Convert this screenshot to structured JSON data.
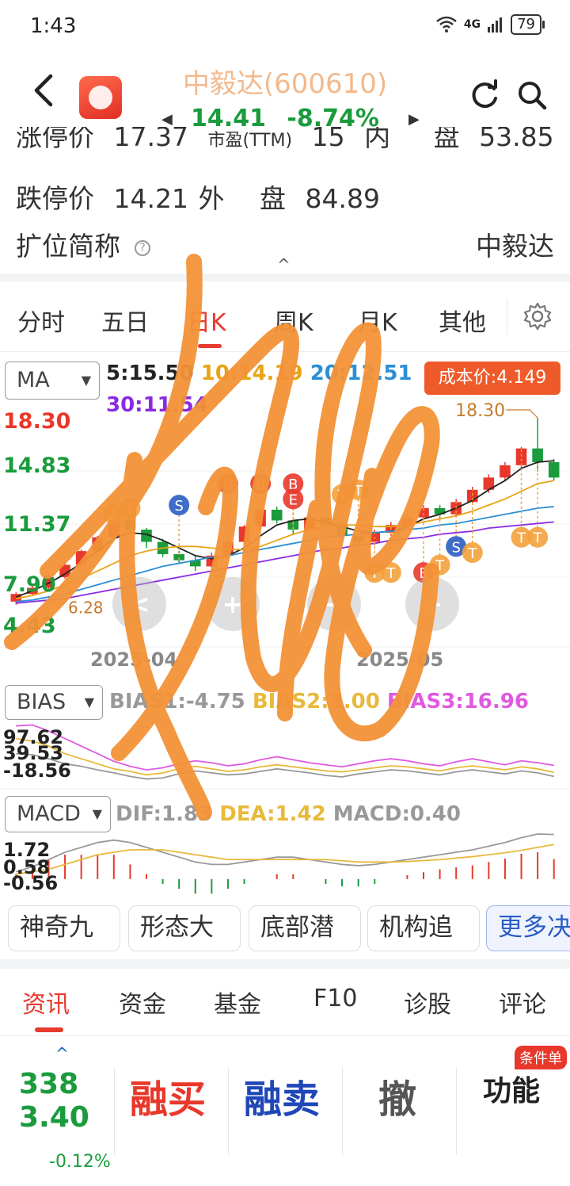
{
  "status_bar": {
    "time": "1:43",
    "network": "4G",
    "battery": "79"
  },
  "header": {
    "stock_name": "中毅达(600610)",
    "price": "14.41",
    "change_pct": "-8.74%",
    "prev_arrow": "◀",
    "next_arrow": "▶"
  },
  "info": {
    "row_cut": {
      "a": "涨停价",
      "b": "17.37",
      "c": "市盈(TTM)",
      "d": "15",
      "e": "内",
      "f": "盘",
      "g": "53.85"
    },
    "limit_down_label": "跌停价",
    "limit_down_value": "14.21",
    "outer_label": "外",
    "outer_mid": "盘",
    "outer_value": "84.89",
    "short_name_label": "扩位简称",
    "short_name_value": "中毅达"
  },
  "chart_tabs": [
    {
      "label": "分时"
    },
    {
      "label": "五日"
    },
    {
      "label": "日K"
    },
    {
      "label": "周K"
    },
    {
      "label": "月K"
    },
    {
      "label": "其他"
    }
  ],
  "ma": {
    "selector": "MA",
    "ma5": "5:15.50",
    "ma10": "10:14.19",
    "ma20": "20:12.51",
    "ma30": "30:11.54",
    "cost_price": "成本价:4.149",
    "colors": {
      "ma5": "#222222",
      "ma10": "#e8a417",
      "ma20": "#2b8fd6",
      "ma30": "#8b2be2"
    }
  },
  "chart_data": {
    "type": "candlestick",
    "price_axis_labels": [
      "18.30",
      "14.83",
      "11.37",
      "7.90",
      "4.43"
    ],
    "ylim": [
      4.43,
      18.3
    ],
    "high_annotation": "18.30",
    "low_annotation": "6.28",
    "x_labels": [
      "2025-04",
      "2025-05"
    ],
    "candles": [
      [
        6.3,
        6.8,
        6.1,
        6.9
      ],
      [
        6.8,
        7.2,
        6.7,
        7.4
      ],
      [
        7.2,
        7.9,
        7.0,
        8.1
      ],
      [
        7.9,
        8.7,
        7.8,
        8.8
      ],
      [
        8.7,
        9.6,
        8.6,
        9.7
      ],
      [
        9.6,
        10.5,
        9.4,
        10.6
      ],
      [
        10.5,
        11.6,
        10.3,
        11.7
      ],
      [
        11.6,
        11.0,
        10.8,
        11.9
      ],
      [
        11.0,
        10.2,
        9.8,
        11.1
      ],
      [
        10.2,
        9.4,
        9.2,
        10.4
      ],
      [
        9.4,
        9.0,
        8.8,
        9.6
      ],
      [
        9.0,
        8.6,
        8.3,
        9.3
      ],
      [
        8.6,
        9.3,
        8.5,
        9.5
      ],
      [
        9.3,
        10.2,
        9.1,
        10.3
      ],
      [
        10.2,
        11.2,
        10.0,
        11.3
      ],
      [
        11.2,
        12.3,
        11.0,
        12.4
      ],
      [
        12.3,
        11.6,
        11.4,
        12.5
      ],
      [
        11.6,
        11.0,
        10.7,
        11.8
      ],
      [
        11.0,
        11.8,
        10.9,
        12.0
      ],
      [
        11.8,
        11.3,
        11.1,
        12.0
      ],
      [
        11.3,
        10.6,
        10.4,
        11.4
      ],
      [
        10.6,
        10.2,
        9.9,
        10.8
      ],
      [
        10.2,
        10.8,
        10.0,
        11.0
      ],
      [
        10.8,
        11.3,
        10.6,
        11.5
      ],
      [
        11.3,
        11.8,
        11.1,
        12.0
      ],
      [
        11.8,
        12.4,
        11.6,
        12.6
      ],
      [
        12.4,
        12.0,
        11.7,
        12.6
      ],
      [
        12.0,
        12.8,
        11.9,
        13.0
      ],
      [
        12.8,
        13.6,
        12.6,
        13.8
      ],
      [
        13.6,
        14.4,
        13.4,
        14.6
      ],
      [
        14.4,
        15.2,
        14.2,
        15.4
      ],
      [
        15.2,
        16.3,
        15.0,
        16.4
      ],
      [
        16.3,
        15.4,
        14.8,
        18.3
      ],
      [
        15.4,
        14.4,
        14.2,
        15.6
      ]
    ],
    "ma_lines": {
      "ma5": [
        6.6,
        7.0,
        7.5,
        8.1,
        8.8,
        9.6,
        10.4,
        10.8,
        10.7,
        10.3,
        9.8,
        9.3,
        9.1,
        9.3,
        9.8,
        10.6,
        11.3,
        11.6,
        11.7,
        11.5,
        11.2,
        10.9,
        10.8,
        10.9,
        11.2,
        11.7,
        12.0,
        12.4,
        12.9,
        13.6,
        14.2,
        15.0,
        15.4,
        15.5
      ],
      "ma10": [
        6.5,
        6.7,
        7.0,
        7.4,
        7.8,
        8.3,
        8.8,
        9.3,
        9.6,
        9.8,
        9.9,
        9.9,
        9.8,
        9.7,
        9.7,
        9.9,
        10.3,
        10.7,
        11.0,
        11.2,
        11.3,
        11.3,
        11.2,
        11.2,
        11.3,
        11.5,
        11.7,
        11.9,
        12.2,
        12.6,
        13.0,
        13.5,
        14.0,
        14.2
      ],
      "ma20": [
        6.3,
        6.4,
        6.6,
        6.8,
        7.1,
        7.4,
        7.7,
        8.0,
        8.3,
        8.6,
        8.8,
        9.0,
        9.2,
        9.3,
        9.5,
        9.7,
        9.9,
        10.1,
        10.3,
        10.5,
        10.6,
        10.7,
        10.8,
        10.9,
        11.0,
        11.1,
        11.3,
        11.4,
        11.6,
        11.8,
        12.0,
        12.2,
        12.4,
        12.5
      ],
      "ma30": [
        6.2,
        6.3,
        6.4,
        6.5,
        6.7,
        6.9,
        7.1,
        7.3,
        7.5,
        7.7,
        7.9,
        8.1,
        8.3,
        8.5,
        8.7,
        8.9,
        9.1,
        9.3,
        9.5,
        9.7,
        9.8,
        10.0,
        10.1,
        10.3,
        10.4,
        10.5,
        10.7,
        10.8,
        10.9,
        11.1,
        11.2,
        11.3,
        11.4,
        11.5
      ]
    },
    "markers": [
      {
        "i": 6,
        "label": "T",
        "price": 12.0
      },
      {
        "i": 7,
        "label": "T",
        "price": 12.4
      },
      {
        "i": 10,
        "label": "S",
        "price": 12.6
      },
      {
        "i": 13,
        "label": "B",
        "price": 14.0
      },
      {
        "i": 15,
        "label": "B",
        "price": 14.0
      },
      {
        "i": 17,
        "label": "B",
        "price": 14.0
      },
      {
        "i": 17,
        "label": "E",
        "price": 13.0
      },
      {
        "i": 20,
        "label": "T",
        "price": 13.3
      },
      {
        "i": 21,
        "label": "T",
        "price": 13.6
      },
      {
        "i": 22,
        "label": "T",
        "price": 8.2
      },
      {
        "i": 23,
        "label": "T",
        "price": 8.2
      },
      {
        "i": 25,
        "label": "E",
        "price": 8.2
      },
      {
        "i": 26,
        "label": "T",
        "price": 8.7
      },
      {
        "i": 27,
        "label": "S",
        "price": 9.9
      },
      {
        "i": 28,
        "label": "T",
        "price": 9.5
      },
      {
        "i": 31,
        "label": "T",
        "price": 10.5
      },
      {
        "i": 32,
        "label": "T",
        "price": 10.5
      }
    ]
  },
  "bias": {
    "selector": "BIAS",
    "bias1": "BIAS1:-4.75",
    "bias2": "BIAS2:3.00",
    "bias3": "BIAS3:16.96",
    "axis": [
      "97.62",
      "39.53",
      "-18.56"
    ],
    "colors": {
      "bias1": "#999999",
      "bias2": "#e8b93a",
      "bias3": "#e05ae0"
    },
    "values": {
      "bias1": [
        40,
        38,
        30,
        20,
        15,
        8,
        2,
        -5,
        -10,
        -8,
        0,
        6,
        2,
        -2,
        0,
        5,
        10,
        6,
        2,
        -3,
        -6,
        0,
        4,
        8,
        6,
        2,
        -2,
        4,
        8,
        4,
        0,
        6,
        2,
        -5
      ],
      "bias2": [
        70,
        65,
        55,
        40,
        30,
        20,
        10,
        5,
        -2,
        2,
        10,
        15,
        10,
        5,
        8,
        14,
        18,
        14,
        10,
        6,
        4,
        8,
        12,
        16,
        14,
        10,
        6,
        12,
        16,
        12,
        8,
        14,
        10,
        3
      ],
      "bias3": [
        95,
        97,
        85,
        70,
        55,
        40,
        25,
        15,
        8,
        12,
        20,
        26,
        22,
        16,
        20,
        28,
        34,
        28,
        22,
        18,
        14,
        20,
        26,
        30,
        26,
        20,
        16,
        24,
        30,
        24,
        18,
        26,
        22,
        17
      ]
    }
  },
  "macd": {
    "selector": "MACD",
    "dif": "DIF:1.83",
    "dea": "DEA:1.42",
    "macd": "MACD:0.40",
    "axis": [
      "1.72",
      "0.58",
      "-0.56"
    ],
    "colors": {
      "dif": "#999999",
      "dea": "#e8b93a",
      "up": "#e8382b",
      "down": "#1a9b3c"
    },
    "values": {
      "dif": [
        0.3,
        0.5,
        0.8,
        1.1,
        1.3,
        1.5,
        1.6,
        1.5,
        1.3,
        1.1,
        0.9,
        0.7,
        0.6,
        0.6,
        0.7,
        0.8,
        0.9,
        0.9,
        0.8,
        0.7,
        0.6,
        0.55,
        0.6,
        0.7,
        0.8,
        0.9,
        1.0,
        1.1,
        1.2,
        1.35,
        1.5,
        1.7,
        1.85,
        1.83
      ],
      "dea": [
        0.2,
        0.3,
        0.4,
        0.6,
        0.8,
        1.0,
        1.1,
        1.2,
        1.2,
        1.2,
        1.1,
        1.0,
        0.9,
        0.8,
        0.8,
        0.8,
        0.8,
        0.8,
        0.8,
        0.8,
        0.75,
        0.7,
        0.7,
        0.7,
        0.72,
        0.76,
        0.8,
        0.86,
        0.92,
        1.0,
        1.08,
        1.18,
        1.3,
        1.42
      ],
      "hist": [
        0.2,
        0.4,
        0.8,
        1.0,
        1.0,
        1.0,
        1.0,
        0.6,
        0.2,
        -0.2,
        -0.4,
        -0.6,
        -0.6,
        -0.4,
        -0.2,
        0.0,
        0.2,
        0.2,
        0.0,
        -0.2,
        -0.3,
        -0.3,
        -0.2,
        0.0,
        0.16,
        0.28,
        0.4,
        0.48,
        0.56,
        0.7,
        0.84,
        1.04,
        1.1,
        0.82
      ]
    }
  },
  "strategies": [
    {
      "label": "神奇九"
    },
    {
      "label": "形态大"
    },
    {
      "label": "底部潜"
    },
    {
      "label": "机构追"
    },
    {
      "label": "更多决"
    }
  ],
  "bottom_tabs": [
    {
      "label": "资讯"
    },
    {
      "label": "资金"
    },
    {
      "label": "基金"
    },
    {
      "label": "F10"
    },
    {
      "label": "诊股"
    },
    {
      "label": "评论"
    }
  ],
  "trade": {
    "index_value": "3383.40",
    "index_change": "-0.12%",
    "buy": "融买",
    "sell": "融卖",
    "cancel": "撤",
    "function": "功能",
    "condition_badge": "条件单",
    "colors": {
      "buy": "#e8382b",
      "sell": "#1f47b8",
      "cancel": "#555555",
      "function": "#222222"
    }
  },
  "annotation_overlay_color": "#f39237"
}
